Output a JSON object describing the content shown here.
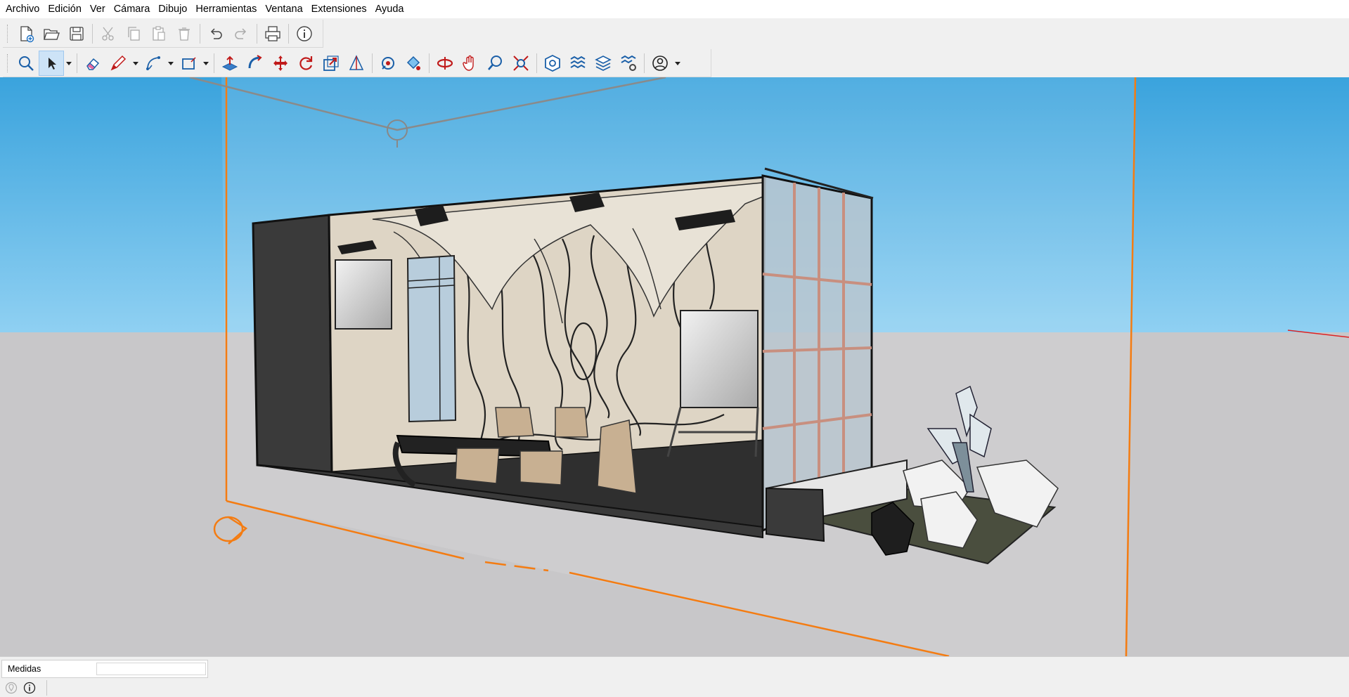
{
  "menu": {
    "file": "Archivo",
    "edit": "Edición",
    "view": "Ver",
    "camera": "Cámara",
    "draw": "Dibujo",
    "tools": "Herramientas",
    "window": "Ventana",
    "extensions": "Extensiones",
    "help": "Ayuda"
  },
  "toolbar_top": [
    "new-file-icon",
    "open-folder-icon",
    "save-icon",
    "cut-icon",
    "copy-icon",
    "paste-icon",
    "delete-icon",
    "undo-icon",
    "redo-icon",
    "print-icon",
    "model-info-icon"
  ],
  "toolbar_main": [
    "search-icon",
    "select-arrow-icon",
    "eraser-icon",
    "pencil-line-icon",
    "arc-icon",
    "rectangle-icon",
    "push-pull-icon",
    "follow-me-icon",
    "move-icon",
    "rotate-icon",
    "scale-icon",
    "protractor-icon",
    "paint-bucket-icon",
    "orbit-icon",
    "pan-icon",
    "zoom-icon",
    "zoom-extents-icon",
    "warehouse-icon",
    "extension-warehouse-icon",
    "layers-icon",
    "extension-manager-icon",
    "profile-icon"
  ],
  "status": {
    "measures_label": "Medidas",
    "measures_value": ""
  },
  "colors": {
    "sky_top": "#3aa3dd",
    "sky_bottom": "#8fd0f2",
    "ground": "#c8c7c9",
    "selection_orange": "#f47c12",
    "active_tool": "#cde3f7"
  }
}
